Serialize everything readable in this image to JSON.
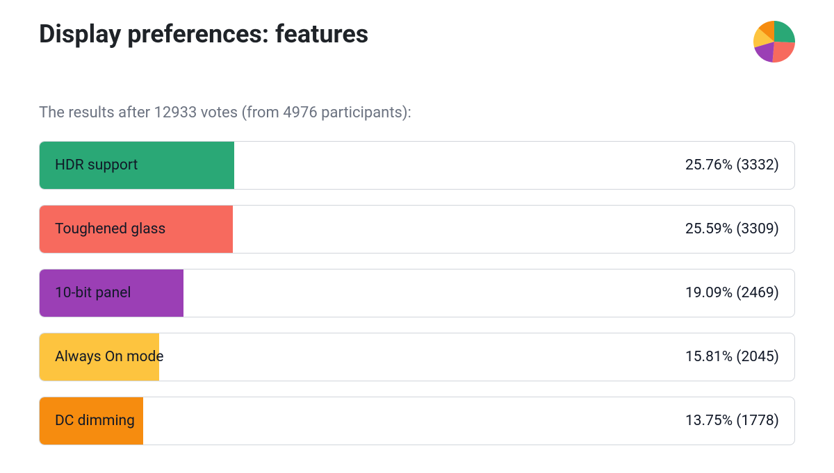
{
  "title": "Display preferences: features",
  "subtitle": "The results after 12933 votes (from 4976 participants):",
  "bars": [
    {
      "label": "HDR support",
      "value": "25.76% (3332)",
      "fill_pct": 25.76,
      "color": "#2aa876"
    },
    {
      "label": "Toughened glass",
      "value": "25.59% (3309)",
      "fill_pct": 25.59,
      "color": "#f76a5e"
    },
    {
      "label": "10-bit panel",
      "value": "19.09% (2469)",
      "fill_pct": 19.09,
      "color": "#9b3fb5"
    },
    {
      "label": "Always On mode",
      "value": "15.81% (2045)",
      "fill_pct": 15.81,
      "color": "#fdc43f"
    },
    {
      "label": "DC dimming",
      "value": "13.75% (1778)",
      "fill_pct": 13.75,
      "color": "#f68c0f"
    }
  ],
  "pie": [
    {
      "pct": 25.76,
      "color": "#2aa876"
    },
    {
      "pct": 25.59,
      "color": "#f76a5e"
    },
    {
      "pct": 19.09,
      "color": "#9b3fb5"
    },
    {
      "pct": 15.81,
      "color": "#fdc43f"
    },
    {
      "pct": 13.75,
      "color": "#f68c0f"
    }
  ],
  "chart_data": {
    "type": "bar",
    "title": "Display preferences: features",
    "subtitle": "The results after 12933 votes (from 4976 participants):",
    "total_votes": 12933,
    "participants": 4976,
    "categories": [
      "HDR support",
      "Toughened glass",
      "10-bit panel",
      "Always On mode",
      "DC dimming"
    ],
    "series": [
      {
        "name": "percent",
        "values": [
          25.76,
          25.59,
          19.09,
          15.81,
          13.75
        ]
      },
      {
        "name": "count",
        "values": [
          3332,
          3309,
          2469,
          2045,
          1778
        ]
      }
    ],
    "colors": [
      "#2aa876",
      "#f76a5e",
      "#9b3fb5",
      "#fdc43f",
      "#f68c0f"
    ],
    "xlabel": "",
    "ylabel": "",
    "ylim": [
      0,
      100
    ]
  }
}
